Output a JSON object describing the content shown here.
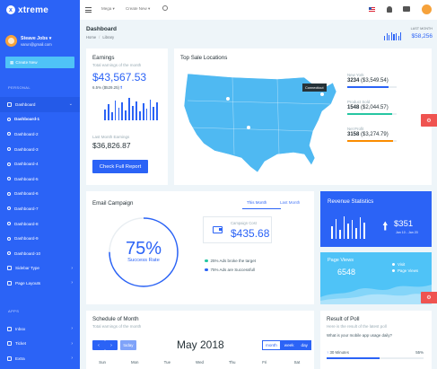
{
  "brand": {
    "name": "xtreme",
    "logo": "x"
  },
  "profile": {
    "name": "Steave Jobs",
    "email": "varun@gmail.com"
  },
  "sidebar": {
    "create_label": "Create New",
    "personal_label": "PERSONAL",
    "dashboard_label": "Dashboard",
    "sub_items": [
      "Dashboard-1",
      "Dashboard-2",
      "Dashboard-3",
      "Dashboard-4",
      "Dashboard-5",
      "Dashboard-6",
      "Dashboard-7",
      "Dashboard-8",
      "Dashboard-9",
      "Dashboard-10"
    ],
    "sidebar_type_label": "Sidebar Type",
    "page_layouts_label": "Page Layouts",
    "apps_label": "APPS",
    "apps": [
      "Inbox",
      "Ticket",
      "Extra"
    ]
  },
  "topbar": {
    "mega_label": "Mega",
    "create_label": "Create New"
  },
  "page": {
    "title": "Dashboard",
    "breadcrumb": [
      "Home",
      "Library"
    ],
    "last_month_label": "LAST MONTH",
    "last_month_value": "$58,256"
  },
  "earnings": {
    "title": "Earnings",
    "subtitle": "Total earnings of the month",
    "value": "$43,567.53",
    "change": "6.5% ($529.25)",
    "last_month_label": "Last Month Earnings",
    "last_month_value": "$36,826.87",
    "button_label": "Check Full Report"
  },
  "sales": {
    "title": "Top Sale Locations",
    "tooltip": "Connecticut",
    "stats": [
      {
        "label": "New York",
        "value": "3234",
        "amount": "($3,549.54)",
        "color": "#2b63f6",
        "fill": 0.84
      },
      {
        "label": "Product Sold",
        "value": "1548",
        "amount": "($2,044.57)",
        "color": "#26c6a2",
        "fill": 0.91
      },
      {
        "label": "Net Profit",
        "value": "3158",
        "amount": "($3,274.79)",
        "color": "#fb8c00",
        "fill": 0.93
      }
    ]
  },
  "email": {
    "title": "Email Campaign",
    "tab_this_month": "This Month",
    "tab_last_month": "Last Month",
    "rate_value": "75%",
    "rate_label": "Success Rate",
    "rate_fraction": 0.75,
    "cost_label": "Campaign Cost",
    "cost_value": "$435.68",
    "legend": [
      {
        "text": "25% Ads broke the target",
        "color": "#26c6a2"
      },
      {
        "text": "75% Ads are Successfull",
        "color": "#2b63f6"
      }
    ]
  },
  "revenue": {
    "title": "Revenue Statistics",
    "value": "$351",
    "dates": "Jan 10 - Jan 20"
  },
  "page_views": {
    "title": "Page Views",
    "value": "6548",
    "legend": [
      "Visit",
      "Page Views"
    ]
  },
  "schedule": {
    "title": "Schedule of Month",
    "subtitle": "Total earnings of the month",
    "today_label": "today",
    "month_title": "May 2018",
    "views": [
      "month",
      "week",
      "day"
    ],
    "prev_icon": "‹",
    "next_icon": "›",
    "days": [
      "Sun",
      "Mon",
      "Tue",
      "Wed",
      "Thu",
      "Fri",
      "Sat"
    ]
  },
  "poll": {
    "title": "Result of Poll",
    "subtitle": "Here is the result of the latest poll",
    "question": "What is your mobile app usage daily?",
    "option": "30 Minutes",
    "percent": "55%",
    "fraction": 0.55
  },
  "colors": {
    "primary": "#2b63f6",
    "info": "#4fc3f7",
    "success": "#26c6a2",
    "warning": "#fb8c00",
    "danger": "#ef5350"
  },
  "icons": {
    "menu": "menu-icon",
    "search": "search-icon",
    "notify": "bell-icon",
    "chat": "chat-icon",
    "settings": "gear-icon"
  }
}
